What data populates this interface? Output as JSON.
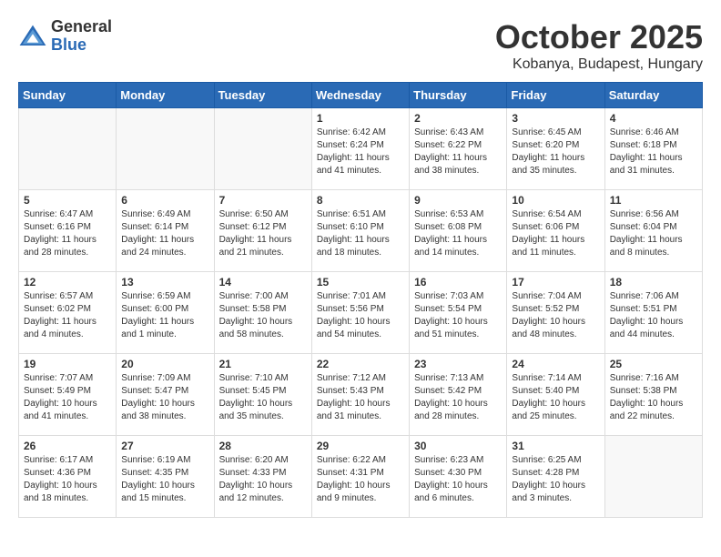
{
  "header": {
    "logo": {
      "general": "General",
      "blue": "Blue"
    },
    "title": "October 2025",
    "location": "Kobanya, Budapest, Hungary"
  },
  "weekdays": [
    "Sunday",
    "Monday",
    "Tuesday",
    "Wednesday",
    "Thursday",
    "Friday",
    "Saturday"
  ],
  "weeks": [
    [
      {
        "day": "",
        "sunrise": "",
        "sunset": "",
        "daylight": ""
      },
      {
        "day": "",
        "sunrise": "",
        "sunset": "",
        "daylight": ""
      },
      {
        "day": "",
        "sunrise": "",
        "sunset": "",
        "daylight": ""
      },
      {
        "day": "1",
        "sunrise": "6:42 AM",
        "sunset": "6:24 PM",
        "daylight": "11 hours and 41 minutes."
      },
      {
        "day": "2",
        "sunrise": "6:43 AM",
        "sunset": "6:22 PM",
        "daylight": "11 hours and 38 minutes."
      },
      {
        "day": "3",
        "sunrise": "6:45 AM",
        "sunset": "6:20 PM",
        "daylight": "11 hours and 35 minutes."
      },
      {
        "day": "4",
        "sunrise": "6:46 AM",
        "sunset": "6:18 PM",
        "daylight": "11 hours and 31 minutes."
      }
    ],
    [
      {
        "day": "5",
        "sunrise": "6:47 AM",
        "sunset": "6:16 PM",
        "daylight": "11 hours and 28 minutes."
      },
      {
        "day": "6",
        "sunrise": "6:49 AM",
        "sunset": "6:14 PM",
        "daylight": "11 hours and 24 minutes."
      },
      {
        "day": "7",
        "sunrise": "6:50 AM",
        "sunset": "6:12 PM",
        "daylight": "11 hours and 21 minutes."
      },
      {
        "day": "8",
        "sunrise": "6:51 AM",
        "sunset": "6:10 PM",
        "daylight": "11 hours and 18 minutes."
      },
      {
        "day": "9",
        "sunrise": "6:53 AM",
        "sunset": "6:08 PM",
        "daylight": "11 hours and 14 minutes."
      },
      {
        "day": "10",
        "sunrise": "6:54 AM",
        "sunset": "6:06 PM",
        "daylight": "11 hours and 11 minutes."
      },
      {
        "day": "11",
        "sunrise": "6:56 AM",
        "sunset": "6:04 PM",
        "daylight": "11 hours and 8 minutes."
      }
    ],
    [
      {
        "day": "12",
        "sunrise": "6:57 AM",
        "sunset": "6:02 PM",
        "daylight": "11 hours and 4 minutes."
      },
      {
        "day": "13",
        "sunrise": "6:59 AM",
        "sunset": "6:00 PM",
        "daylight": "11 hours and 1 minute."
      },
      {
        "day": "14",
        "sunrise": "7:00 AM",
        "sunset": "5:58 PM",
        "daylight": "10 hours and 58 minutes."
      },
      {
        "day": "15",
        "sunrise": "7:01 AM",
        "sunset": "5:56 PM",
        "daylight": "10 hours and 54 minutes."
      },
      {
        "day": "16",
        "sunrise": "7:03 AM",
        "sunset": "5:54 PM",
        "daylight": "10 hours and 51 minutes."
      },
      {
        "day": "17",
        "sunrise": "7:04 AM",
        "sunset": "5:52 PM",
        "daylight": "10 hours and 48 minutes."
      },
      {
        "day": "18",
        "sunrise": "7:06 AM",
        "sunset": "5:51 PM",
        "daylight": "10 hours and 44 minutes."
      }
    ],
    [
      {
        "day": "19",
        "sunrise": "7:07 AM",
        "sunset": "5:49 PM",
        "daylight": "10 hours and 41 minutes."
      },
      {
        "day": "20",
        "sunrise": "7:09 AM",
        "sunset": "5:47 PM",
        "daylight": "10 hours and 38 minutes."
      },
      {
        "day": "21",
        "sunrise": "7:10 AM",
        "sunset": "5:45 PM",
        "daylight": "10 hours and 35 minutes."
      },
      {
        "day": "22",
        "sunrise": "7:12 AM",
        "sunset": "5:43 PM",
        "daylight": "10 hours and 31 minutes."
      },
      {
        "day": "23",
        "sunrise": "7:13 AM",
        "sunset": "5:42 PM",
        "daylight": "10 hours and 28 minutes."
      },
      {
        "day": "24",
        "sunrise": "7:14 AM",
        "sunset": "5:40 PM",
        "daylight": "10 hours and 25 minutes."
      },
      {
        "day": "25",
        "sunrise": "7:16 AM",
        "sunset": "5:38 PM",
        "daylight": "10 hours and 22 minutes."
      }
    ],
    [
      {
        "day": "26",
        "sunrise": "6:17 AM",
        "sunset": "4:36 PM",
        "daylight": "10 hours and 18 minutes."
      },
      {
        "day": "27",
        "sunrise": "6:19 AM",
        "sunset": "4:35 PM",
        "daylight": "10 hours and 15 minutes."
      },
      {
        "day": "28",
        "sunrise": "6:20 AM",
        "sunset": "4:33 PM",
        "daylight": "10 hours and 12 minutes."
      },
      {
        "day": "29",
        "sunrise": "6:22 AM",
        "sunset": "4:31 PM",
        "daylight": "10 hours and 9 minutes."
      },
      {
        "day": "30",
        "sunrise": "6:23 AM",
        "sunset": "4:30 PM",
        "daylight": "10 hours and 6 minutes."
      },
      {
        "day": "31",
        "sunrise": "6:25 AM",
        "sunset": "4:28 PM",
        "daylight": "10 hours and 3 minutes."
      },
      {
        "day": "",
        "sunrise": "",
        "sunset": "",
        "daylight": ""
      }
    ]
  ]
}
